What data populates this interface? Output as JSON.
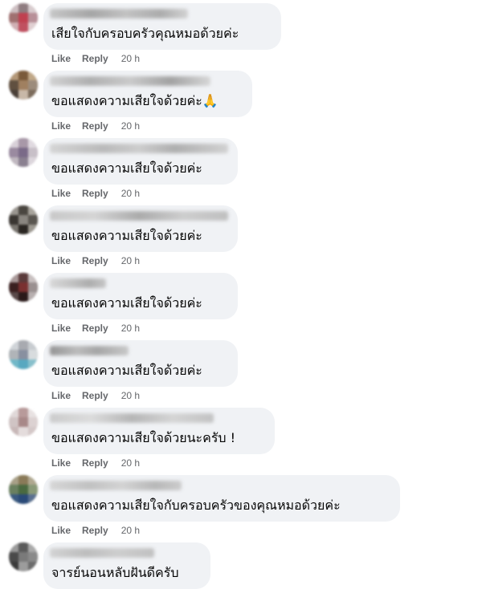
{
  "comments": [
    {
      "text": "เสียใจกับครอบครัวคุณหมอด้วยค่ะ",
      "like": "Like",
      "reply": "Reply",
      "time": "20 h"
    },
    {
      "text": "ขอแสดงความเสียใจด้วยค่ะ🙏",
      "like": "Like",
      "reply": "Reply",
      "time": "20 h"
    },
    {
      "text": "ขอแสดงความเสียใจด้วยค่ะ",
      "like": "Like",
      "reply": "Reply",
      "time": "20 h"
    },
    {
      "text": "ขอแสดงความเสียใจด้วยค่ะ",
      "like": "Like",
      "reply": "Reply",
      "time": "20 h"
    },
    {
      "text": "ขอแสดงความเสียใจด้วยค่ะ",
      "like": "Like",
      "reply": "Reply",
      "time": "20 h"
    },
    {
      "text": "ขอแสดงความเสียใจด้วยค่ะ",
      "like": "Like",
      "reply": "Reply",
      "time": "20 h"
    },
    {
      "text": "ขอแสดงความเสียใจด้วยนะครับ !",
      "like": "Like",
      "reply": "Reply",
      "time": "20 h"
    },
    {
      "text": "ขอแสดงความเสียใจกับครอบครัวของคุณหมอด้วยค่ะ",
      "like": "Like",
      "reply": "Reply",
      "time": "20 h"
    },
    {
      "text": "จารย์นอนหลับฝันดีครับ"
    }
  ]
}
